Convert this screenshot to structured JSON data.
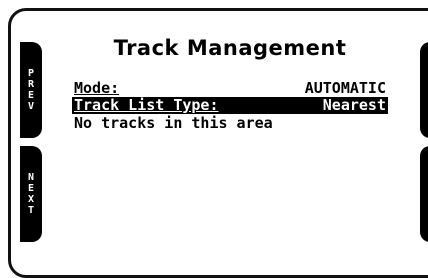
{
  "side_buttons": {
    "left_top": "PREV",
    "left_bottom": "NEXT"
  },
  "screen": {
    "title": "Track Management",
    "rows": [
      {
        "label": "Mode:",
        "value": "AUTOMATIC"
      },
      {
        "label": "Track List Type:",
        "value": "Nearest"
      },
      {
        "label": "No tracks in this area",
        "value": ""
      }
    ]
  }
}
